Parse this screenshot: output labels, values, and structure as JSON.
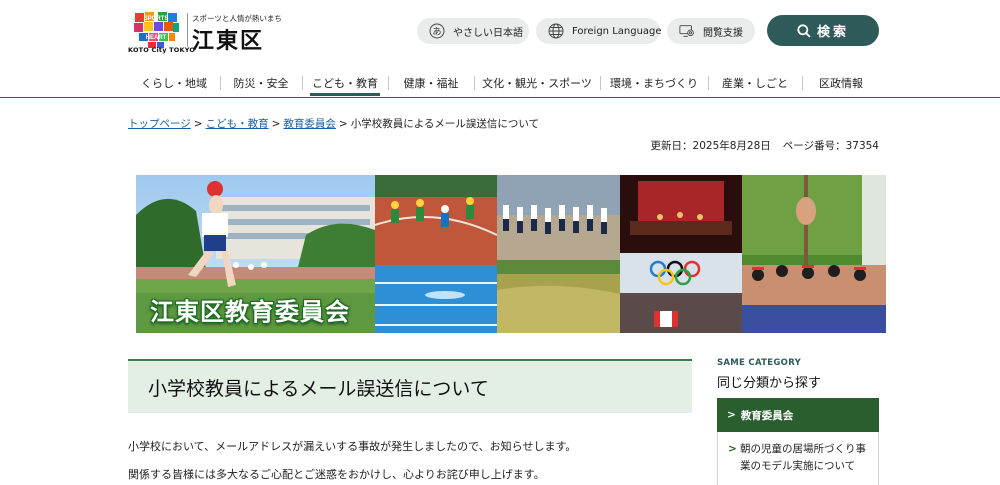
{
  "header": {
    "logo_line1": "SPORTS",
    "logo_line2": "HEART",
    "logo_city": "KOTO City TOKYO",
    "tagline": "スポーツと人情が熱いまち",
    "city_name": "江東区",
    "easy_japanese": "やさしい日本語",
    "easy_japanese_glyph": "あ",
    "foreign_language": "Foreign Language",
    "reading_support": "閲覧支援",
    "search_label": "検索"
  },
  "nav": {
    "items": [
      {
        "label": "くらし・地域"
      },
      {
        "label": "防災・安全"
      },
      {
        "label": "こども・教育"
      },
      {
        "label": "健康・福祉"
      },
      {
        "label": "文化・観光・スポーツ"
      },
      {
        "label": "環境・まちづくり"
      },
      {
        "label": "産業・しごと"
      },
      {
        "label": "区政情報"
      }
    ],
    "active_index": 2
  },
  "breadcrumb": {
    "top": "トップページ",
    "category": "こども・教育",
    "subcategory": "教育委員会",
    "current": "小学校教員によるメール誤送信について",
    "separator": ">"
  },
  "meta": {
    "updated": "更新日：2025年8月28日",
    "page_number": "ページ番号：37354"
  },
  "banner": {
    "title": "江東区教育委員会"
  },
  "main": {
    "heading": "小学校教員によるメール誤送信について",
    "paragraph1": "小学校において、メールアドレスが漏えいする事故が発生しましたので、お知らせします。",
    "paragraph2": "関係する皆様には多大なるご心配とご迷惑をおかけし、心よりお詫び申し上げます。"
  },
  "sidebar": {
    "kicker": "SAME CATEGORY",
    "title": "同じ分類から探す",
    "active_item": "教育委員会",
    "arrow": ">",
    "items": [
      {
        "label": "朝の児童の居場所づくり事業のモデル実施について"
      }
    ]
  },
  "colors": {
    "accent": "#2e5a5a",
    "green_dark": "#2a5e2f",
    "heading_bg": "#e3efe5",
    "link": "#1a5fa0"
  }
}
